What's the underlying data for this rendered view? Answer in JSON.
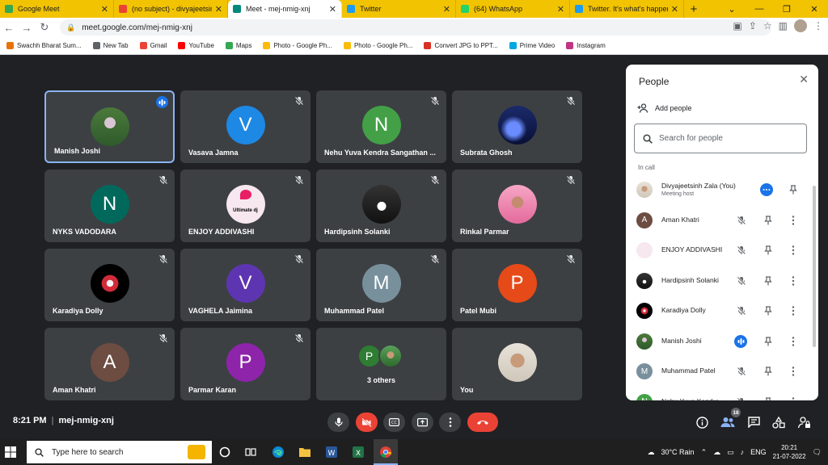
{
  "browser": {
    "tabs": [
      {
        "title": "Google Meet",
        "color": "#34a853"
      },
      {
        "title": "(no subject) - divyajeetsinh",
        "color": "#ea4335"
      },
      {
        "title": "Meet - mej-nmig-xnj",
        "color": "#00897b"
      },
      {
        "title": "Twitter",
        "color": "#1d9bf0"
      },
      {
        "title": "(64) WhatsApp",
        "color": "#25d366"
      },
      {
        "title": "Twitter. It's what's happening",
        "color": "#1d9bf0"
      }
    ],
    "url": "meet.google.com/mej-nmig-xnj",
    "bookmarks": [
      {
        "label": "Swachh Bharat Sum...",
        "color": "#e8710a"
      },
      {
        "label": "New Tab",
        "color": "#5f6368"
      },
      {
        "label": "Gmail",
        "color": "#ea4335"
      },
      {
        "label": "YouTube",
        "color": "#ff0000"
      },
      {
        "label": "Maps",
        "color": "#34a853"
      },
      {
        "label": "Photo - Google Ph...",
        "color": "#fbbc04"
      },
      {
        "label": "Photo - Google Ph...",
        "color": "#fbbc04"
      },
      {
        "label": "Convert JPG to PPT...",
        "color": "#d93025"
      },
      {
        "label": "Prime Video",
        "color": "#00a8e1"
      },
      {
        "label": "Instagram",
        "color": "#c13584"
      }
    ]
  },
  "tiles": [
    {
      "name": "Manish Joshi",
      "initial": "",
      "photo": "photo-green",
      "speaking": true
    },
    {
      "name": "Vasava Jamna",
      "initial": "V",
      "color": "#1e88e5"
    },
    {
      "name": "Nehu Yuva Kendra Sangathan ...",
      "initial": "N",
      "color": "#43a047"
    },
    {
      "name": "Subrata Ghosh",
      "initial": "",
      "photo": "photo-concert"
    },
    {
      "name": "NYKS VADODARA",
      "initial": "N",
      "color": "#00695c"
    },
    {
      "name": "ENJOY ADDIVASHI",
      "initial": "",
      "photo": "photo-dj",
      "logo_text": "Ultimate dj"
    },
    {
      "name": "Hardipsinh Solanki",
      "initial": "",
      "photo": "photo-man"
    },
    {
      "name": "Rinkal Parmar",
      "initial": "",
      "photo": "photo-woman"
    },
    {
      "name": "Karadiya Dolly",
      "initial": "",
      "photo": "photo-flower"
    },
    {
      "name": "VAGHELA Jaimina",
      "initial": "V",
      "color": "#5e35b1"
    },
    {
      "name": "Muhammad Patel",
      "initial": "M",
      "color": "#78909c"
    },
    {
      "name": "Patel Mubi",
      "initial": "P",
      "color": "#e64a19"
    },
    {
      "name": "Aman Khatri",
      "initial": "A",
      "color": "#6d4c41"
    },
    {
      "name": "Parmar Karan",
      "initial": "P",
      "color": "#8e24aa"
    },
    {
      "name": "",
      "others": true,
      "others_label": "3 others",
      "initial": "P",
      "color": "#2e7d32"
    },
    {
      "name": "You",
      "initial": "",
      "photo": "photo-you",
      "self": true
    }
  ],
  "people_panel": {
    "title": "People",
    "add_people": "Add people",
    "search_placeholder": "Search for people",
    "section": "In call",
    "participants": [
      {
        "name": "Divyajeetsinh Zala (You)",
        "sub": "Meeting host",
        "photo": "photo-you",
        "initial": "",
        "host": true
      },
      {
        "name": "Aman Khatri",
        "initial": "A",
        "color": "#6d4c41"
      },
      {
        "name": "ENJOY ADDIVASHI",
        "photo": "photo-dj",
        "initial": ""
      },
      {
        "name": "Hardipsinh Solanki",
        "photo": "photo-man",
        "initial": ""
      },
      {
        "name": "Karadiya Dolly",
        "photo": "photo-flower",
        "initial": ""
      },
      {
        "name": "Manish Joshi",
        "photo": "photo-green",
        "initial": "",
        "speaking": true
      },
      {
        "name": "Muhammad Patel",
        "initial": "M",
        "color": "#78909c"
      },
      {
        "name": "Nehu Yuva Kendra",
        "initial": "N",
        "color": "#43a047"
      }
    ]
  },
  "meeting": {
    "time": "8:21 PM",
    "code": "mej-nmig-xnj",
    "participant_count": "18"
  },
  "taskbar": {
    "search_placeholder": "Type here to search",
    "weather": "30°C Rain",
    "language": "ENG",
    "time": "20:21",
    "date": "21-07-2022"
  }
}
